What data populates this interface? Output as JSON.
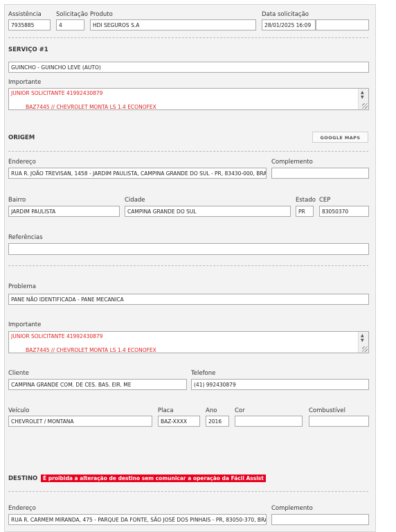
{
  "header": {
    "assistencia_label": "Assistência",
    "assistencia_value": "7935885",
    "solicitacao_label": "Solicitação",
    "solicitacao_value": "4",
    "produto_label": "Produto",
    "produto_value": "HDI SEGUROS S.A",
    "data_label": "Data solicitação",
    "data_value": "28/01/2025 16:09",
    "extra_value": ""
  },
  "servico": {
    "title": "SERVIÇO #1",
    "value": "GUINCHO - GUINCHO LEVE (AUTO)",
    "importante_label": "Importante",
    "importante_line1": "JUNIOR SOLICITANTE 41992430879",
    "importante_line2": "BAZ7445 // CHEVROLET MONTA LS 1.4 ECONOFEX"
  },
  "origem": {
    "title": "ORIGEM",
    "maps_button": "GOOGLE MAPS",
    "endereco_label": "Endereço",
    "endereco_value": "RUA R. JOÃO TREVISAN, 1458 - JARDIM PAULISTA, CAMPINA GRANDE DO SUL - PR, 83430-000, BRAS",
    "complemento_label": "Complemento",
    "complemento_value": "",
    "bairro_label": "Bairro",
    "bairro_value": "JARDIM PAULISTA",
    "cidade_label": "Cidade",
    "cidade_value": "CAMPINA GRANDE DO SUL",
    "estado_label": "Estado",
    "estado_value": "PR",
    "cep_label": "CEP",
    "cep_value": "83050370",
    "referencias_label": "Referências",
    "referencias_value": ""
  },
  "problema": {
    "label": "Problema",
    "value": "PANE NÃO IDENTIFICADA - PANE MECANICA",
    "importante_label": "Importante",
    "importante_line1": "JUNIOR SOLICITANTE 41992430879",
    "importante_line2": "BAZ7445 // CHEVROLET MONTA LS 1.4 ECONOFEX"
  },
  "cliente": {
    "cliente_label": "Cliente",
    "cliente_value": "CAMPINA GRANDE COM. DE CES. BAS. EIR. ME",
    "telefone_label": "Telefone",
    "telefone_value": "(41) 992430879"
  },
  "veiculo": {
    "veiculo_label": "Veículo",
    "veiculo_value": "CHEVROLET / MONTANA",
    "placa_label": "Placa",
    "placa_value": "BAZ-XXXX",
    "ano_label": "Ano",
    "ano_value": "2016",
    "cor_label": "Cor",
    "cor_value": "",
    "combustivel_label": "Combustível",
    "combustivel_value": ""
  },
  "destino": {
    "title": "DESTINO",
    "warning": "É proibida a alteração de destino sem comunicar a operação da Fácil Assist",
    "endereco_label": "Endereço",
    "endereco_value": "RUA R. CARMEM MIRANDA, 475 - PARQUE DA FONTE, SÃO JOSÉ DOS PINHAIS - PR, 83050-370, BRAS",
    "complemento_label": "Complemento",
    "complemento_value": ""
  },
  "colors": {
    "warning_bg": "#e8001e",
    "important_text": "#e02020"
  },
  "icons": {
    "scroll_up": "▲",
    "scroll_down": "▼"
  }
}
